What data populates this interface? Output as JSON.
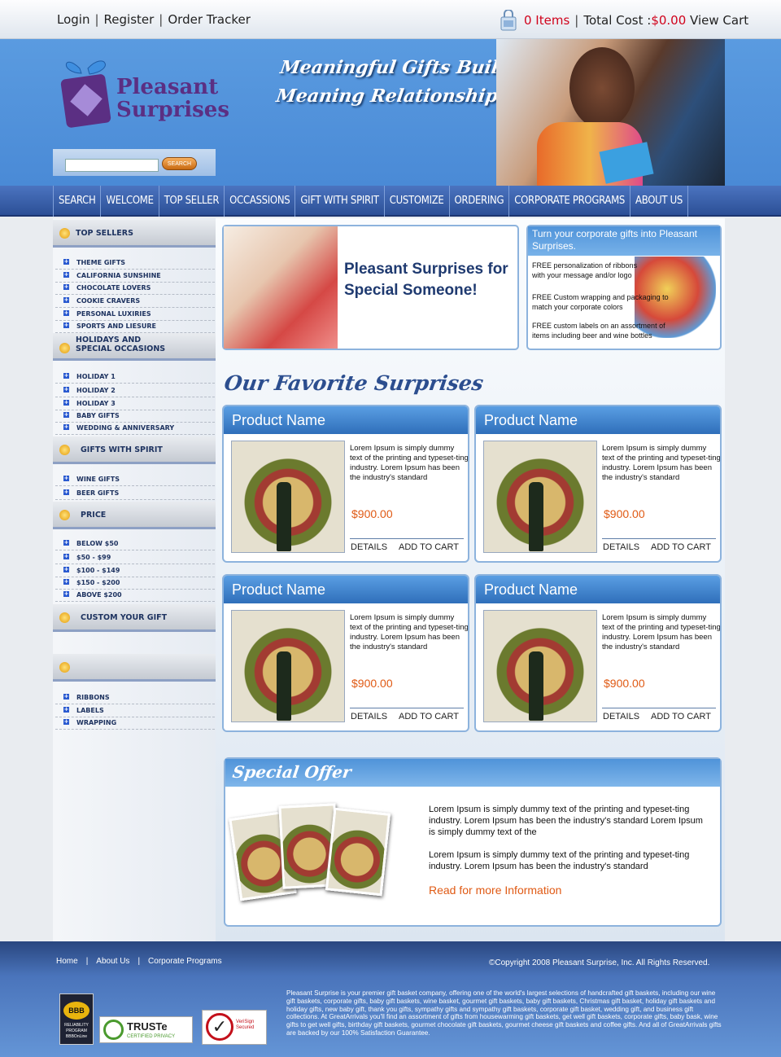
{
  "topbar": {
    "links": [
      "Login",
      "Register",
      "Order Tracker"
    ],
    "cart": {
      "count_label": "0 Items",
      "total_label": "Total Cost :",
      "total_value": "$0.00",
      "view_cart": "View Cart"
    }
  },
  "header": {
    "logo_line1": "Pleasant",
    "logo_line2": "Surprises",
    "tagline_line1": "Meaningful Gifts Build",
    "tagline_line2": "Meaning Relationships",
    "search_button": "SEARCH"
  },
  "nav": [
    "SEARCH",
    "WELCOME",
    "TOP SELLER",
    "OCCASSIONS",
    "GIFT WITH SPIRIT",
    "CUSTOMIZE",
    "ORDERING",
    "CORPORATE PROGRAMS",
    "ABOUT US"
  ],
  "sidebar": {
    "top_sellers": {
      "title": "TOP SELLERS",
      "items": [
        "Theme Gifts",
        "California Sunshine",
        "Chocolate Lovers",
        "Cookie Cravers",
        "Personal Luxiries",
        "Sports and Liesure"
      ]
    },
    "holidays": {
      "title_line1": "HOLIDAYS AND",
      "title_line2": "SPECIAL OCCASIONS",
      "items": [
        "Holiday 1",
        "Holiday 2",
        "Holiday 3",
        "Baby Gifts",
        "Wedding & Anniversary"
      ]
    },
    "spirit": {
      "title": "GIFTS WITH SPIRIT",
      "items": [
        "Wine Gifts",
        "Beer Gifts"
      ]
    },
    "price": {
      "title": "PRICE",
      "items": [
        "Below $50",
        "$50 - $99",
        "$100 - $149",
        "$150 - $200",
        "Above $200"
      ]
    },
    "custom": {
      "title": "CUSTOM YOUR GIFT"
    },
    "extra": {
      "title": "",
      "items": [
        "Ribbons",
        "Labels",
        "Wrapping"
      ]
    }
  },
  "banner": {
    "main_text": "Pleasant Surprises for Special Someone!",
    "corp_head": "Turn your corporate gifts into Pleasant Surprises.",
    "corp_lines": [
      "FREE personalization of ribbons with your message and/or logo",
      "FREE Custom wrapping and packaging to match your corporate colors",
      "FREE custom labels on an assortment of items including beer and wine bottles"
    ]
  },
  "favorites": {
    "title": "Our Favorite Surprises",
    "products": [
      {
        "name": "Product Name",
        "desc": "Lorem Ipsum is simply dummy text of the printing and typeset-ting industry. Lorem Ipsum has been the industry's standard",
        "price": "$900.00",
        "details": "DETAILS",
        "add": "ADD TO CART"
      },
      {
        "name": "Product Name",
        "desc": "Lorem Ipsum is simply dummy text of the printing and typeset-ting industry. Lorem Ipsum has been the industry's standard",
        "price": "$900.00",
        "details": "DETAILS",
        "add": "ADD TO CART"
      },
      {
        "name": "Product Name",
        "desc": "Lorem Ipsum is simply dummy text of the printing and typeset-ting industry. Lorem Ipsum has been the industry's standard",
        "price": "$900.00",
        "details": "DETAILS",
        "add": "ADD TO CART"
      },
      {
        "name": "Product Name",
        "desc": "Lorem Ipsum is simply dummy text of the printing and typeset-ting industry. Lorem Ipsum has been the industry's standard",
        "price": "$900.00",
        "details": "DETAILS",
        "add": "ADD TO CART"
      }
    ]
  },
  "special": {
    "title": "Special Offer",
    "para1": "Lorem Ipsum is simply dummy text of the printing and typeset-ting industry. Lorem Ipsum has been the industry's standard Lorem Ipsum is simply dummy text of the",
    "para2": "Lorem Ipsum is simply dummy text of the printing and typeset-ting industry. Lorem Ipsum has been the industry's standard",
    "link": "Read for more Information"
  },
  "footer": {
    "links": [
      "Home",
      "About Us",
      "Corporate Programs"
    ],
    "copyright": "©Copyright 2008 Pleasant Surprise, Inc.  All Rights Reserved.",
    "text": "Pleasant Surprise is your premier gift basket company, offering one of the world's largest selections of handcrafted gift baskets, including our wine gift baskets, corporate gifts, baby gift baskets, wine basket, gourmet gift baskets, baby gift baskets, Christmas gift basket, holiday gift baskets and holiday gifts, new baby gift, thank you gifts, sympathy gifts and sympathy gift baskets, corporate gift basket, wedding gift, and business gift collections. At GreatArrivals you'll find an assortment of gifts from housewarming gift baskets, get well gift baskets, corporate gifts, baby bask, wine gifts to get well gifts, birthday gift baskets, gourmet chocolate gift baskets, gourmet cheese gift baskets and coffee gifts. And all of GreatArrivals gifts are backed by our 100% Satisfaction Guarantee.",
    "bbb": "BBB",
    "bbb_sub": "RELIABILITY PROGRAM BBBOnLine",
    "truste": "TRUSTe",
    "truste_sub": "CERTIFIED PRIVACY",
    "verisign": "VeriSign Secured"
  }
}
